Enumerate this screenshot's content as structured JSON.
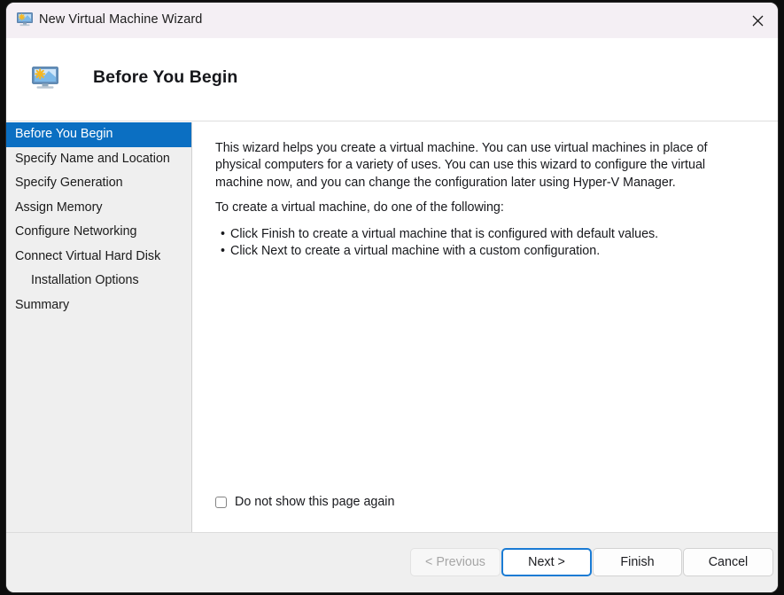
{
  "window": {
    "title": "New Virtual Machine Wizard",
    "title_icon": "virtual-machine-monitor-icon",
    "close_icon": "close-icon",
    "accent_color": "#0b6fc2",
    "titlebar_bg": "#f4eff4",
    "sidebar_bg": "#efefef",
    "footer_bg": "#efefef"
  },
  "header": {
    "title": "Before You Begin",
    "icon": "virtual-machine-monitor-icon"
  },
  "sidebar": {
    "items": [
      {
        "label": "Before You Begin",
        "selected": true,
        "indented": false
      },
      {
        "label": "Specify Name and Location",
        "selected": false,
        "indented": false
      },
      {
        "label": "Specify Generation",
        "selected": false,
        "indented": false
      },
      {
        "label": "Assign Memory",
        "selected": false,
        "indented": false
      },
      {
        "label": "Configure Networking",
        "selected": false,
        "indented": false
      },
      {
        "label": "Connect Virtual Hard Disk",
        "selected": false,
        "indented": false
      },
      {
        "label": "Installation Options",
        "selected": false,
        "indented": true
      },
      {
        "label": "Summary",
        "selected": false,
        "indented": false
      }
    ]
  },
  "content": {
    "paragraph1": "This wizard helps you create a virtual machine. You can use virtual machines in place of physical computers for a variety of uses. You can use this wizard to configure the virtual machine now, and you can change the configuration later using Hyper-V Manager.",
    "paragraph2": "To create a virtual machine, do one of the following:",
    "bullet_glyph": "•",
    "bullets": [
      "Click Finish to create a virtual machine that is configured with default values.",
      "Click Next to create a virtual machine with a custom configuration."
    ],
    "checkbox": {
      "label": "Do not show this page again",
      "checked": false
    }
  },
  "footer": {
    "buttons": [
      {
        "id": "previous",
        "label": "< Previous",
        "disabled": true,
        "focused": false
      },
      {
        "id": "next",
        "label": "Next >",
        "disabled": false,
        "focused": true
      },
      {
        "id": "finish",
        "label": "Finish",
        "disabled": false,
        "focused": false
      },
      {
        "id": "cancel",
        "label": "Cancel",
        "disabled": false,
        "focused": false
      }
    ]
  }
}
